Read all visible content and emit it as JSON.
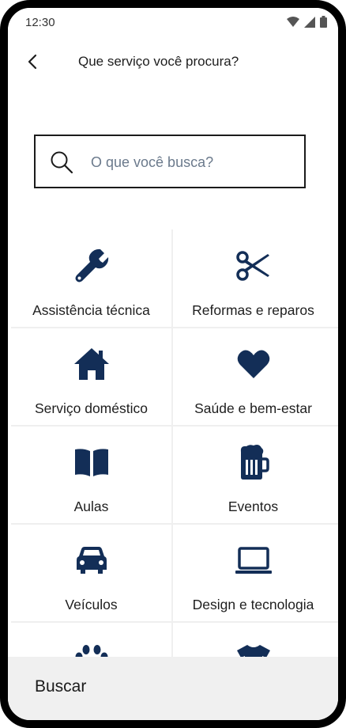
{
  "status": {
    "time": "12:30"
  },
  "header": {
    "title": "Que serviço você procura?"
  },
  "search": {
    "placeholder": "O que você busca?"
  },
  "categories": [
    {
      "label": "Assistência técnica",
      "icon": "wrench-icon"
    },
    {
      "label": "Reformas e reparos",
      "icon": "scissors-icon"
    },
    {
      "label": "Serviço doméstico",
      "icon": "house-icon"
    },
    {
      "label": "Saúde e bem-estar",
      "icon": "heart-icon"
    },
    {
      "label": "Aulas",
      "icon": "book-icon"
    },
    {
      "label": "Eventos",
      "icon": "beer-mug-icon"
    },
    {
      "label": "Veículos",
      "icon": "car-icon"
    },
    {
      "label": "Design e tecnologia",
      "icon": "laptop-icon"
    },
    {
      "label": "",
      "icon": "paw-icon"
    },
    {
      "label": "",
      "icon": "tshirt-icon"
    }
  ],
  "bottom": {
    "button_label": "Buscar"
  },
  "colors": {
    "accent": "#132e57",
    "bottom_bar": "#f0f0f0"
  }
}
